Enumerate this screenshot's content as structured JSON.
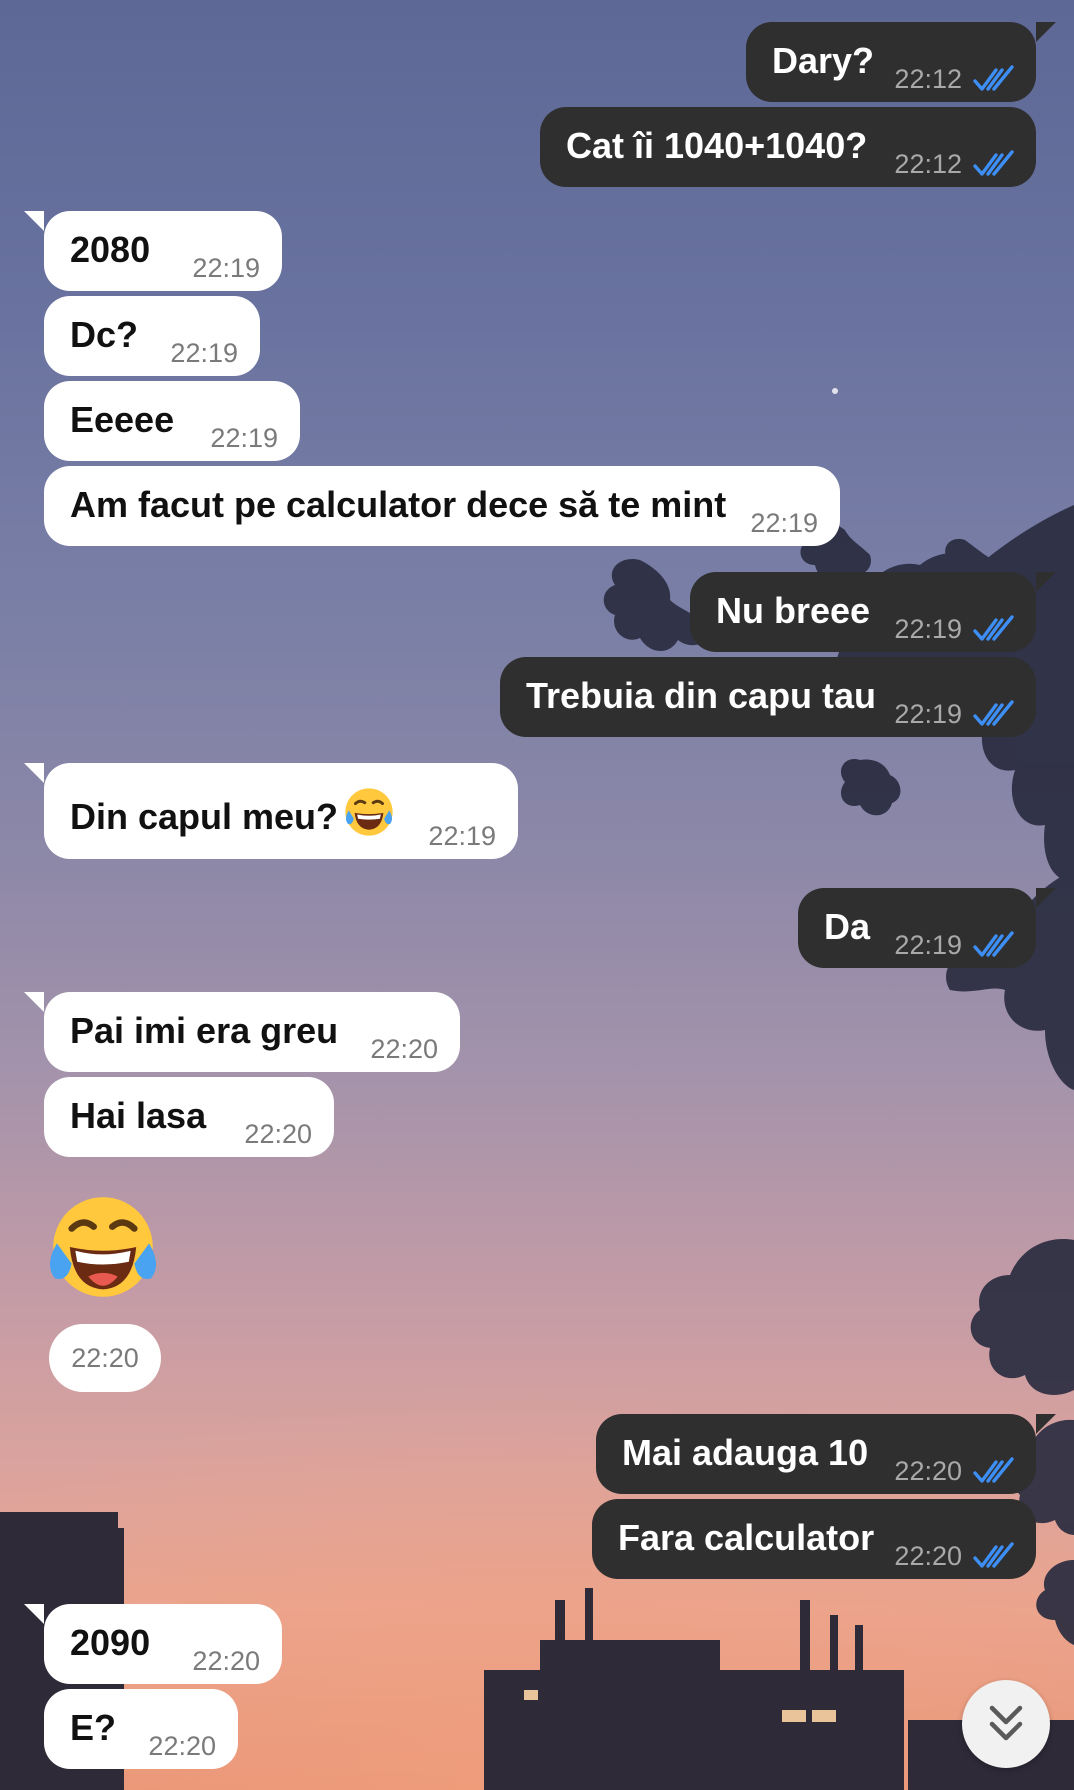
{
  "colors": {
    "outgoing_bubble": "#2f2f2f",
    "incoming_bubble": "#ffffff",
    "read_ticks": "#3d8ef5",
    "outgoing_time": "#a9a9a9",
    "incoming_time": "#7a7a7a"
  },
  "messages": [
    {
      "direction": "outgoing",
      "text": "Dary?",
      "time": "22:12",
      "status": "read"
    },
    {
      "direction": "outgoing",
      "text": "Cat îi 1040+1040?",
      "time": "22:12",
      "status": "read"
    },
    {
      "direction": "incoming",
      "text": "2080",
      "time": "22:19"
    },
    {
      "direction": "incoming",
      "text": "Dc?",
      "time": "22:19"
    },
    {
      "direction": "incoming",
      "text": "Eeeee",
      "time": "22:19"
    },
    {
      "direction": "incoming",
      "text": "Am facut pe calculator dece să te mint",
      "time": "22:19"
    },
    {
      "direction": "outgoing",
      "text": "Nu breee",
      "time": "22:19",
      "status": "read"
    },
    {
      "direction": "outgoing",
      "text": "Trebuia din capu tau",
      "time": "22:19",
      "status": "read"
    },
    {
      "direction": "incoming",
      "text": "Din capul meu?",
      "emoji": "face-with-tears-of-joy",
      "time": "22:19"
    },
    {
      "direction": "outgoing",
      "text": "Da",
      "time": "22:19",
      "status": "read"
    },
    {
      "direction": "incoming",
      "text": "Pai imi era greu",
      "time": "22:20"
    },
    {
      "direction": "incoming",
      "text": "Hai lasa",
      "time": "22:20"
    },
    {
      "direction": "incoming",
      "type": "emoji-only",
      "emoji": "face-with-tears-of-joy",
      "time": "22:20"
    },
    {
      "direction": "outgoing",
      "text": "Mai adauga 10",
      "time": "22:20",
      "status": "read"
    },
    {
      "direction": "outgoing",
      "text": "Fara calculator",
      "time": "22:20",
      "status": "read"
    },
    {
      "direction": "incoming",
      "text": "2090",
      "time": "22:20"
    },
    {
      "direction": "incoming",
      "text": "E?",
      "time": "22:20"
    }
  ],
  "scroll_button": {
    "icon": "double-chevron-down-icon"
  }
}
